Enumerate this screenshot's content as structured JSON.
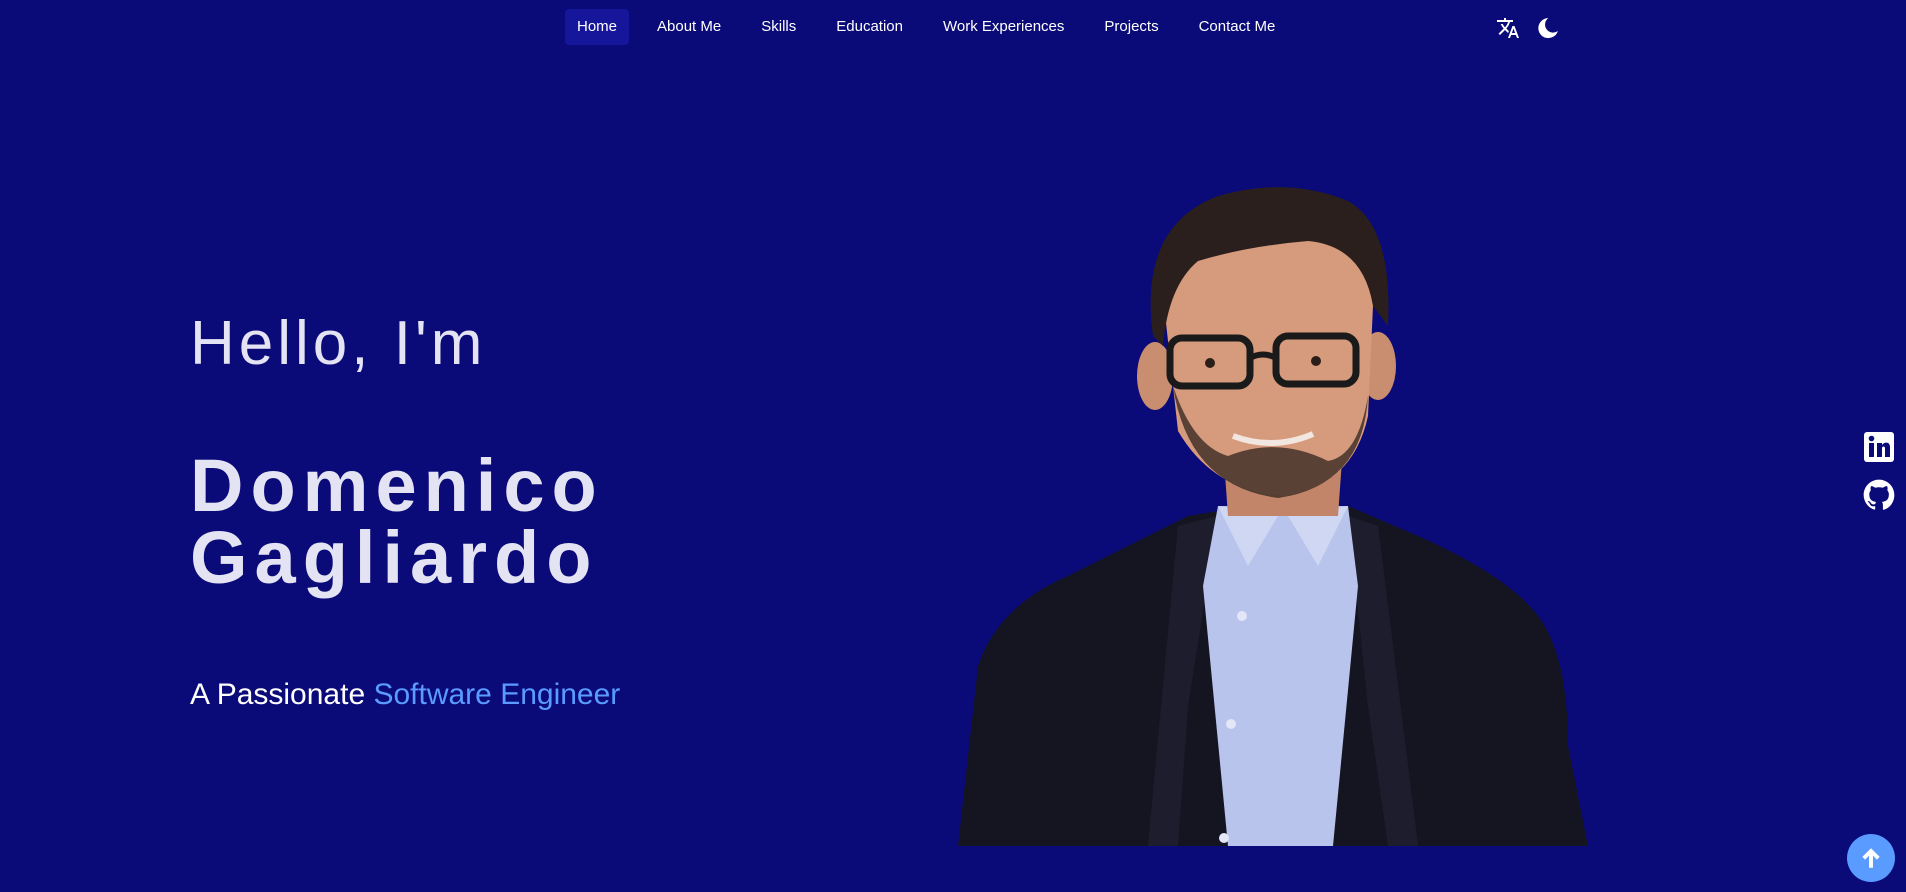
{
  "nav": {
    "items": [
      {
        "label": "Home",
        "active": true
      },
      {
        "label": "About Me",
        "active": false
      },
      {
        "label": "Skills",
        "active": false
      },
      {
        "label": "Education",
        "active": false
      },
      {
        "label": "Work Experiences",
        "active": false
      },
      {
        "label": "Projects",
        "active": false
      },
      {
        "label": "Contact Me",
        "active": false
      }
    ],
    "tools": {
      "translate_icon": "translate-icon",
      "theme_icon": "moon-icon"
    }
  },
  "hero": {
    "greeting": "Hello, I'm",
    "name_first": "Domenico",
    "name_last": "Gagliardo",
    "tagline_prefix": "A Passionate ",
    "tagline_accent": "Software Engineer"
  },
  "social": {
    "icons": [
      "linkedin-icon",
      "github-icon"
    ]
  },
  "scroll_top": {
    "icon": "arrow-up-icon"
  },
  "colors": {
    "background": "#0a0a78",
    "accent": "#5a9bff",
    "nav_active": "#16169a",
    "text": "#e3e3f4"
  }
}
